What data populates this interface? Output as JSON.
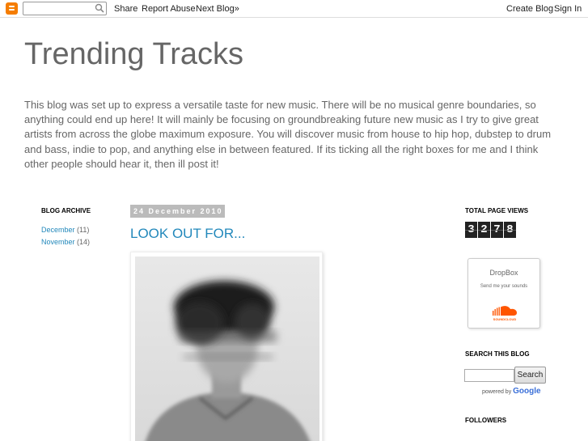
{
  "navbar": {
    "share": "Share",
    "report_abuse": "Report Abuse",
    "next_blog": "Next Blog»",
    "create_blog": "Create Blog",
    "sign_in": "Sign In"
  },
  "header": {
    "title": "Trending Tracks",
    "description": "This blog was set up to express a versatile taste for new music. There will be no musical genre boundaries, so anything could end up here! It will mainly be focusing on groundbreaking future new music as I try to give great artists from across the globe maximum exposure. You will discover music from house to hip hop, dubstep to drum and bass, indie to pop, and anything else in between featured. If its ticking all the right boxes for me and I think other people should hear it, then ill post it!"
  },
  "archive": {
    "title": "Blog Archive",
    "items": [
      {
        "month": "December",
        "count": "(11)"
      },
      {
        "month": "November",
        "count": "(14)"
      }
    ]
  },
  "post": {
    "date": "24 December 2010",
    "title": "LOOK OUT FOR..."
  },
  "pageviews": {
    "title": "Total Page Views",
    "digits": [
      "3",
      "2",
      "7",
      "8"
    ]
  },
  "dropbox": {
    "title": "DropBox",
    "subtitle": "Send me your sounds",
    "brand": "SOUNDCLOUD"
  },
  "search": {
    "title": "Search This Blog",
    "button": "Search",
    "powered_by": "powered by",
    "google": "Google"
  },
  "followers": {
    "title": "Followers"
  },
  "colors": {
    "link": "#2288bb",
    "blogger_orange": "#f57d00",
    "soundcloud_orange": "#ff5500"
  }
}
